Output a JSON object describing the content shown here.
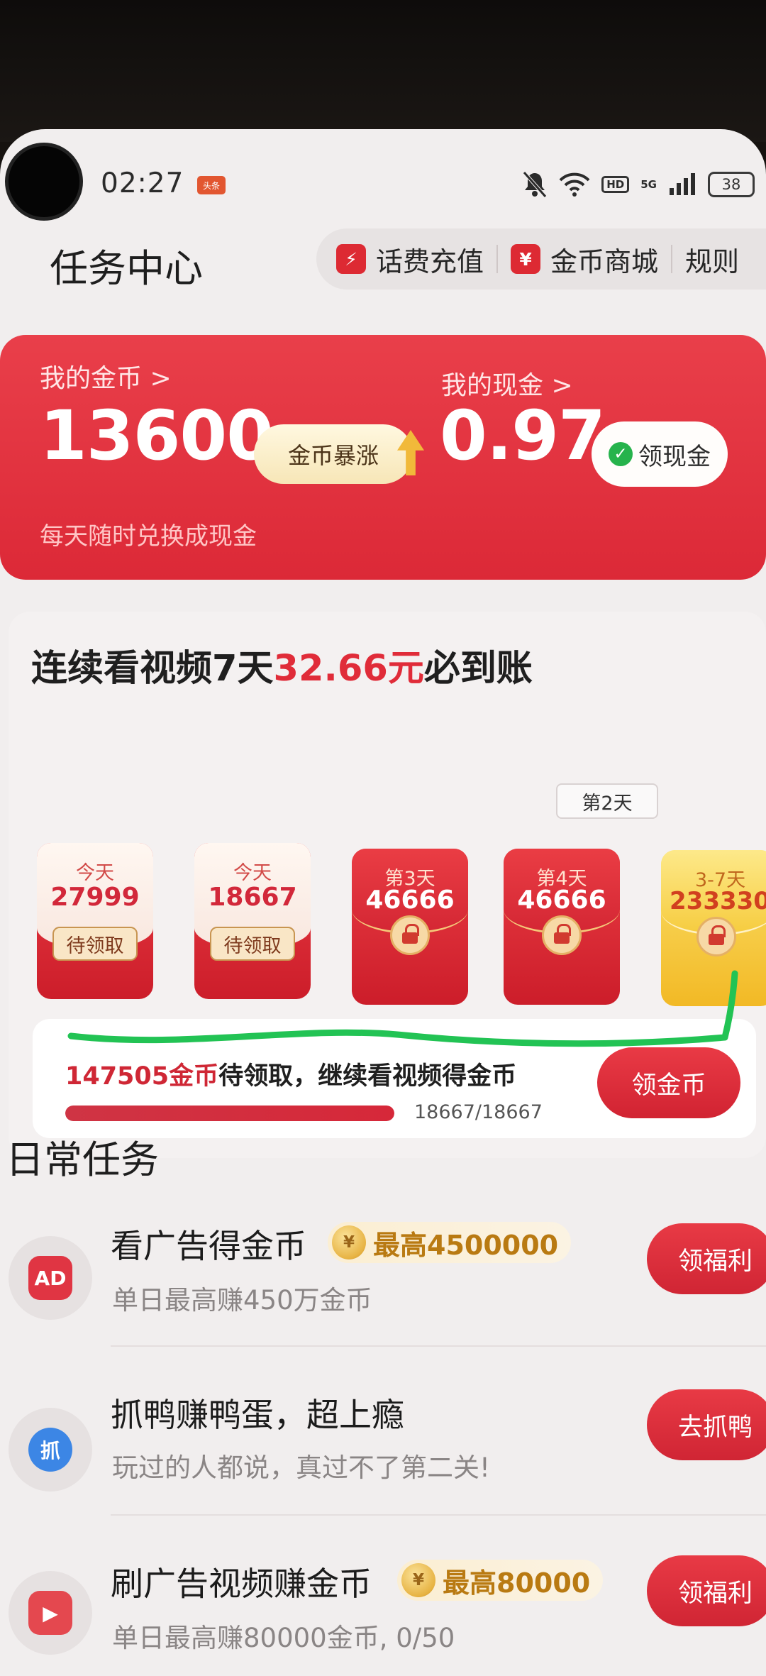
{
  "status_bar": {
    "time": "02:27",
    "app_icon": "头条",
    "hd": "HD",
    "network": "5G",
    "battery": "38",
    "icons": [
      "mute-bell-icon",
      "wifi-icon",
      "signal-icon",
      "battery-icon"
    ]
  },
  "header": {
    "title": "任务中心",
    "pills": [
      {
        "label": "话费充值",
        "icon": "lightning-icon",
        "glyph": "⚡"
      },
      {
        "label": "金币商城",
        "icon": "yen-icon",
        "glyph": "¥"
      },
      {
        "label": "规则"
      }
    ]
  },
  "coins": {
    "my_coins_label": "我的金币 >",
    "my_coins_value": "13600",
    "surge_label": "金币暴涨",
    "my_cash_label": "我的现金 >",
    "my_cash_value": "0.97",
    "claim_cash_label": "领现金",
    "subtitle": "每天随时兑换成现金"
  },
  "streak": {
    "title_prefix": "连续看视频7天",
    "title_amount": "32.66元",
    "title_suffix": "必到账",
    "day_badge": "第2天",
    "envelopes": [
      {
        "day": "今天",
        "amount": "27999",
        "status": "待领取",
        "state": "claimable"
      },
      {
        "day": "今天",
        "amount": "18667",
        "status": "待领取",
        "state": "claimable"
      },
      {
        "day": "第3天",
        "amount": "46666",
        "state": "locked"
      },
      {
        "day": "第4天",
        "amount": "46666",
        "state": "locked"
      },
      {
        "day": "3-7天",
        "amount": "233330",
        "state": "locked-gold"
      }
    ],
    "pending_amount": "147505金币",
    "pending_text": "待领取，继续看视频得金币",
    "progress_label": "18667/18667",
    "progress_fraction": 1.0,
    "claim_button": "领金币"
  },
  "daily": {
    "title": "日常任务",
    "tasks": [
      {
        "title": "看广告得金币",
        "badge": "最高4500000",
        "subtitle": "单日最高赚450万金币",
        "button": "领福利",
        "icon": "ad-icon",
        "icon_text": "AD",
        "icon_color": "#e03543"
      },
      {
        "title": "抓鸭赚鸭蛋，超上瘾",
        "subtitle": "玩过的人都说，真过不了第二关!",
        "button": "去抓鸭",
        "icon": "duck-game-icon",
        "icon_text": "抓",
        "icon_color": "#3c86e5"
      },
      {
        "title": "刷广告视频赚金币",
        "badge": "最高80000",
        "subtitle": "单日最高赚80000金币, 0/50",
        "button": "领福利",
        "icon": "video-icon",
        "icon_text": "▶",
        "icon_color": "#e4484f"
      }
    ]
  },
  "colors": {
    "primary_red": "#e02c39",
    "gold": "#d9a02c",
    "annotation_green": "#22c354"
  }
}
